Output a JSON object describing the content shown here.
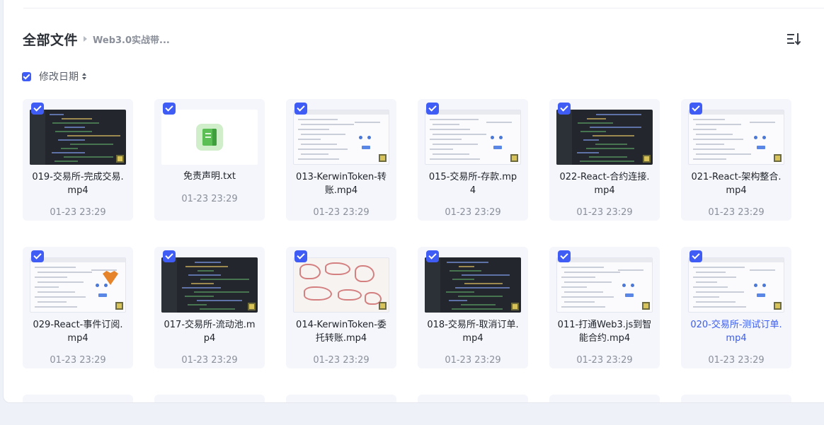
{
  "breadcrumb": {
    "root": "全部文件",
    "current": "Web3.0实战带..."
  },
  "toolbar": {
    "sort_label": "修改日期"
  },
  "files": [
    {
      "name": "019-交易所-完成交易.mp4",
      "date": "01-23 23:29",
      "thumb": "dark",
      "checked": true,
      "highlight": false
    },
    {
      "name": "免责声明.txt",
      "date": "01-23 23:29",
      "thumb": "doc",
      "checked": true,
      "highlight": false
    },
    {
      "name": "013-KerwinToken-转账.mp4",
      "date": "01-23 23:29",
      "thumb": "light",
      "checked": true,
      "highlight": false
    },
    {
      "name": "015-交易所-存款.mp4",
      "date": "01-23 23:29",
      "thumb": "light",
      "checked": true,
      "highlight": false
    },
    {
      "name": "022-React-合约连接.mp4",
      "date": "01-23 23:29",
      "thumb": "dark",
      "checked": true,
      "highlight": false
    },
    {
      "name": "021-React-架构整合.mp4",
      "date": "01-23 23:29",
      "thumb": "light",
      "checked": true,
      "highlight": false
    },
    {
      "name": "029-React-事件订阅.mp4",
      "date": "01-23 23:29",
      "thumb": "light-fox",
      "checked": true,
      "highlight": false
    },
    {
      "name": "017-交易所-流动池.mp4",
      "date": "01-23 23:29",
      "thumb": "dark",
      "checked": true,
      "highlight": false
    },
    {
      "name": "014-KerwinToken-委托转账.mp4",
      "date": "01-23 23:29",
      "thumb": "sketch",
      "checked": true,
      "highlight": false
    },
    {
      "name": "018-交易所-取消订单.mp4",
      "date": "01-23 23:29",
      "thumb": "dark",
      "checked": true,
      "highlight": false
    },
    {
      "name": "011-打通Web3.js到智能合约.mp4",
      "date": "01-23 23:29",
      "thumb": "light",
      "checked": true,
      "highlight": false
    },
    {
      "name": "020-交易所-测试订单.mp4",
      "date": "01-23 23:29",
      "thumb": "light",
      "checked": true,
      "highlight": true
    }
  ],
  "name_lines": [
    [
      "019-交易所-完成交易.",
      "mp4"
    ],
    [
      "免责声明.txt"
    ],
    [
      "013-KerwinToken-转",
      "账.mp4"
    ],
    [
      "015-交易所-存款.mp",
      "4"
    ],
    [
      "022-React-合约连接.",
      "mp4"
    ],
    [
      "021-React-架构整合.",
      "mp4"
    ],
    [
      "029-React-事件订阅.",
      "mp4"
    ],
    [
      "017-交易所-流动池.m",
      "p4"
    ],
    [
      "014-KerwinToken-委",
      "托转账.mp4"
    ],
    [
      "018-交易所-取消订单.",
      "mp4"
    ],
    [
      "011-打通Web3.js到智",
      "能合约.mp4"
    ],
    [
      "020-交易所-测试订单.",
      "mp4"
    ]
  ],
  "icons": {
    "sort_view": "sort-list-icon",
    "doc": "txt-file-icon",
    "check": "checkbox-checked-icon"
  },
  "colors": {
    "accent": "#3f5cf5",
    "highlight_text": "#3a5cf0"
  }
}
